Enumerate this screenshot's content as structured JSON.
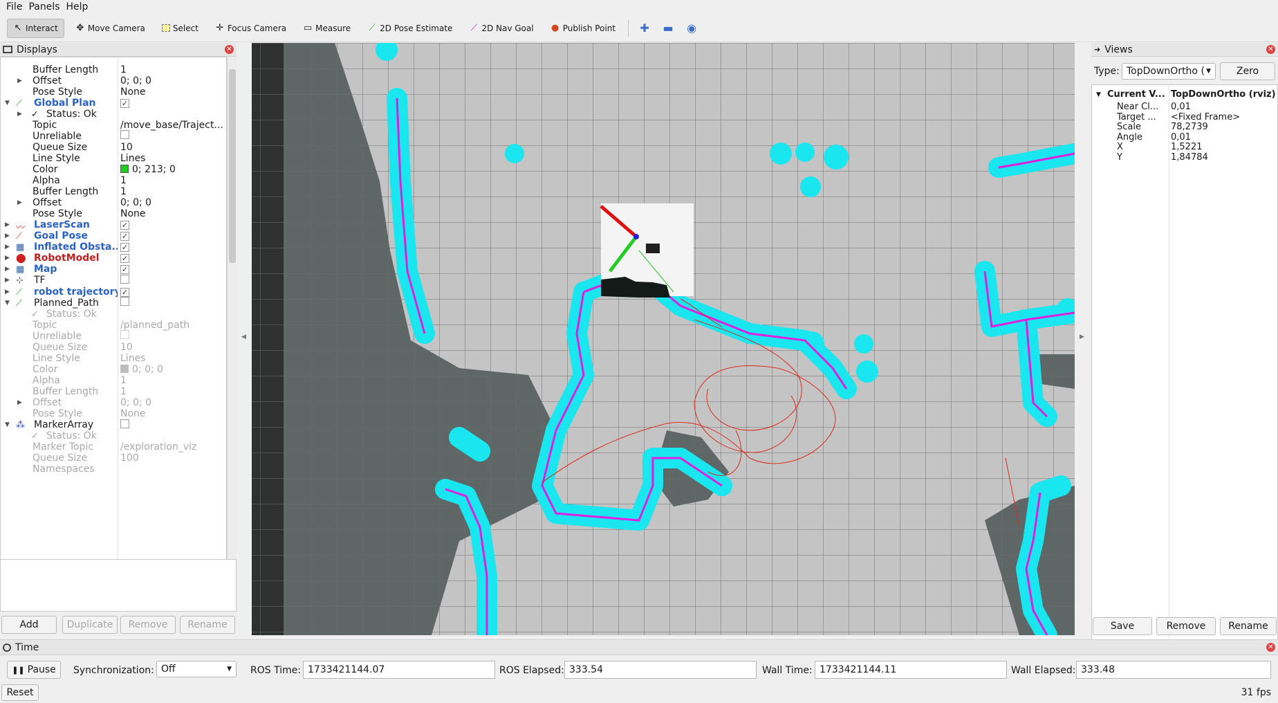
{
  "menubar": {
    "items": [
      "File",
      "Panels",
      "Help"
    ]
  },
  "toolbar": {
    "tools": [
      "Interact",
      "Move Camera",
      "Select",
      "Focus Camera",
      "Measure",
      "2D Pose Estimate",
      "2D Nav Goal",
      "Publish Point"
    ]
  },
  "displays": {
    "title": "Displays",
    "rows": [
      {
        "name": "Buffer Length",
        "value": "1"
      },
      {
        "name": "Offset",
        "value": "0; 0; 0"
      },
      {
        "name": "Pose Style",
        "value": "None"
      },
      {
        "name": "Global Plan",
        "value": ""
      },
      {
        "name": "Status: Ok",
        "value": ""
      },
      {
        "name": "Topic",
        "value": "/move_base/Traject..."
      },
      {
        "name": "Unreliable",
        "value": ""
      },
      {
        "name": "Queue Size",
        "value": "10"
      },
      {
        "name": "Line Style",
        "value": "Lines"
      },
      {
        "name": "Color",
        "value": "0; 213; 0"
      },
      {
        "name": "Alpha",
        "value": "1"
      },
      {
        "name": "Buffer Length",
        "value": "1"
      },
      {
        "name": "Offset",
        "value": "0; 0; 0"
      },
      {
        "name": "Pose Style",
        "value": "None"
      },
      {
        "name": "LaserScan",
        "value": ""
      },
      {
        "name": "Goal Pose",
        "value": ""
      },
      {
        "name": "Inflated Obsta...",
        "value": ""
      },
      {
        "name": "RobotModel",
        "value": ""
      },
      {
        "name": "Map",
        "value": ""
      },
      {
        "name": "TF",
        "value": ""
      },
      {
        "name": "robot trajectory",
        "value": ""
      },
      {
        "name": "Planned_Path",
        "value": ""
      },
      {
        "name": "Status: Ok",
        "value": ""
      },
      {
        "name": "Topic",
        "value": "/planned_path"
      },
      {
        "name": "Unreliable",
        "value": ""
      },
      {
        "name": "Queue Size",
        "value": "10"
      },
      {
        "name": "Line Style",
        "value": "Lines"
      },
      {
        "name": "Color",
        "value": "0; 0; 0"
      },
      {
        "name": "Alpha",
        "value": "1"
      },
      {
        "name": "Buffer Length",
        "value": "1"
      },
      {
        "name": "Offset",
        "value": "0; 0; 0"
      },
      {
        "name": "Pose Style",
        "value": "None"
      },
      {
        "name": "MarkerArray",
        "value": ""
      },
      {
        "name": "Status: Ok",
        "value": ""
      },
      {
        "name": "Marker Topic",
        "value": "/exploration_viz"
      },
      {
        "name": "Queue Size",
        "value": "100"
      },
      {
        "name": "Namespaces",
        "value": ""
      }
    ],
    "buttons": {
      "add": "Add",
      "duplicate": "Duplicate",
      "remove": "Remove",
      "rename": "Rename"
    }
  },
  "views": {
    "title": "Views",
    "type_label": "Type:",
    "type_value": "TopDownOrtho (",
    "zero_label": "Zero",
    "current_view": {
      "name": "Current V...",
      "value": "TopDownOrtho (rviz)"
    },
    "props": [
      {
        "name": "Near Cl...",
        "value": "0,01"
      },
      {
        "name": "Target ...",
        "value": "<Fixed Frame>"
      },
      {
        "name": "Scale",
        "value": "78,2739"
      },
      {
        "name": "Angle",
        "value": "0,01"
      },
      {
        "name": "X",
        "value": "1,5221"
      },
      {
        "name": "Y",
        "value": "1,84784"
      }
    ],
    "buttons": {
      "save": "Save",
      "remove": "Remove",
      "rename": "Rename"
    }
  },
  "time": {
    "title": "Time",
    "pause_label": "Pause",
    "sync_label": "Synchronization:",
    "sync_value": "Off",
    "ros_time_label": "ROS Time:",
    "ros_time": "1733421144.07",
    "ros_elapsed_label": "ROS Elapsed:",
    "ros_elapsed": "333.54",
    "wall_time_label": "Wall Time:",
    "wall_time": "1733421144.11",
    "wall_elapsed_label": "Wall Elapsed:",
    "wall_elapsed": "333.48",
    "reset_label": "Reset",
    "fps": "31 fps"
  },
  "colors": {
    "inflation": "#19e6ef",
    "obstacle": "#e11ee0",
    "trajectory": "#e02a1a",
    "plan": "#22cc22"
  }
}
